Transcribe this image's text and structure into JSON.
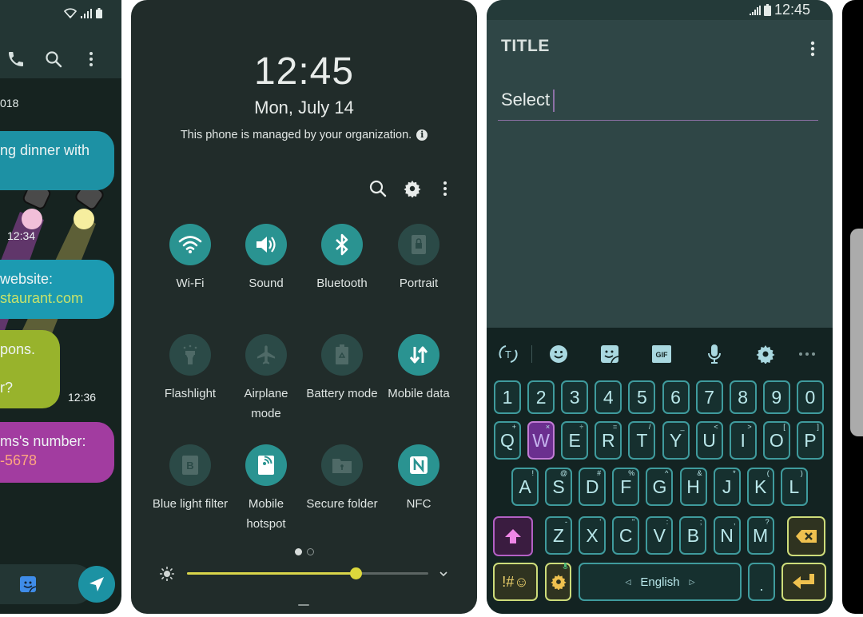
{
  "messages_screen": {
    "status_icons": [
      "wifi-icon",
      "signal-icon",
      "battery-icon"
    ],
    "toolbar_icons": [
      "phone-icon",
      "search-icon",
      "more-vertical-icon"
    ],
    "date_label": "018",
    "messages": [
      {
        "lines": [
          "ng dinner with"
        ],
        "color": "#1d91a4"
      },
      {
        "lines": [
          "website:",
          "staurant.com"
        ],
        "color": "#1c9ab1"
      },
      {
        "lines": [
          "pons.",
          "",
          "r?"
        ],
        "color": "#98b32c",
        "time": "12:36"
      },
      {
        "lines": [
          "ms's number:",
          "-5678"
        ],
        "color": "#a23ca0"
      }
    ],
    "lamp_timestamp": "12:34",
    "composer": {
      "sticker_icon": "sticker-icon",
      "send_icon": "send-icon"
    }
  },
  "quick_panel": {
    "time": "12:45",
    "date": "Mon, July 14",
    "managed_notice": "This phone is managed by your organization.",
    "tools": [
      "search-icon",
      "settings-icon",
      "more-vertical-icon"
    ],
    "tiles": [
      {
        "label": "Wi-Fi",
        "icon": "wifi-icon",
        "on": true
      },
      {
        "label": "Sound",
        "icon": "volume-icon",
        "on": true
      },
      {
        "label": "Bluetooth",
        "icon": "bluetooth-icon",
        "on": true
      },
      {
        "label": "Portrait",
        "icon": "portrait-lock-icon",
        "on": false
      },
      {
        "label": "Flashlight",
        "icon": "flashlight-icon",
        "on": false
      },
      {
        "label": "Airplane mode",
        "icon": "airplane-icon",
        "on": false
      },
      {
        "label": "Battery mode",
        "icon": "battery-saver-icon",
        "on": false
      },
      {
        "label": "Mobile data",
        "icon": "mobile-data-icon",
        "on": true
      },
      {
        "label": "Blue light filter",
        "icon": "blue-light-icon",
        "on": false
      },
      {
        "label": "Mobile hotspot",
        "icon": "hotspot-icon",
        "on": true
      },
      {
        "label": "Secure folder",
        "icon": "secure-folder-icon",
        "on": false
      },
      {
        "label": "NFC",
        "icon": "nfc-icon",
        "on": true
      }
    ],
    "page_indicator": {
      "current": 1,
      "total": 2
    },
    "brightness_percent": 70,
    "accent_color": "#2a9391"
  },
  "editor": {
    "status_time": "12:45",
    "title": "TITLE",
    "input_value": "Select",
    "keyboard": {
      "toolbar": [
        "text-mode-icon",
        "emoji-icon",
        "sticker-icon",
        "gif-icon",
        "mic-icon",
        "settings-icon",
        "more-horizontal-icon"
      ],
      "gif_label": "GIF",
      "number_row": [
        "1",
        "2",
        "3",
        "4",
        "5",
        "6",
        "7",
        "8",
        "9",
        "0"
      ],
      "row1": [
        {
          "k": "Q",
          "h": "+"
        },
        {
          "k": "W",
          "h": "×"
        },
        {
          "k": "E",
          "h": "÷"
        },
        {
          "k": "R",
          "h": "="
        },
        {
          "k": "T",
          "h": "/"
        },
        {
          "k": "Y",
          "h": "_"
        },
        {
          "k": "U",
          "h": "<"
        },
        {
          "k": "I",
          "h": ">"
        },
        {
          "k": "O",
          "h": "["
        },
        {
          "k": "P",
          "h": "]"
        }
      ],
      "row2": [
        {
          "k": "A",
          "h": "!"
        },
        {
          "k": "S",
          "h": "@"
        },
        {
          "k": "D",
          "h": "#"
        },
        {
          "k": "F",
          "h": "%"
        },
        {
          "k": "G",
          "h": "^"
        },
        {
          "k": "H",
          "h": "&"
        },
        {
          "k": "J",
          "h": "*"
        },
        {
          "k": "K",
          "h": "("
        },
        {
          "k": "L",
          "h": ")"
        }
      ],
      "row3": [
        {
          "k": "Z",
          "h": "-"
        },
        {
          "k": "X",
          "h": "'"
        },
        {
          "k": "C",
          "h": "\""
        },
        {
          "k": "V",
          "h": ":"
        },
        {
          "k": "B",
          "h": ";"
        },
        {
          "k": "N",
          "h": ","
        },
        {
          "k": "M",
          "h": "?"
        }
      ],
      "symbols_label": "!#☺",
      "space_label": "English",
      "period_label": ".",
      "highlighted_key": "W"
    }
  }
}
